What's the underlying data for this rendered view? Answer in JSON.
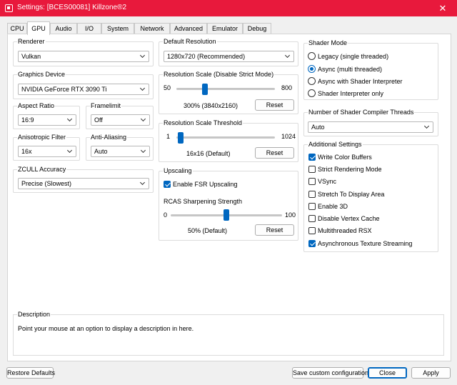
{
  "window": {
    "title": "Settings: [BCES00081] Killzone®2",
    "close_glyph": "✕"
  },
  "tabs": [
    {
      "label": "CPU"
    },
    {
      "label": "GPU"
    },
    {
      "label": "Audio"
    },
    {
      "label": "I/O"
    },
    {
      "label": "System"
    },
    {
      "label": "Network"
    },
    {
      "label": "Advanced"
    },
    {
      "label": "Emulator"
    },
    {
      "label": "Debug"
    }
  ],
  "active_tab": "GPU",
  "renderer": {
    "label": "Renderer",
    "value": "Vulkan"
  },
  "graphics_device": {
    "label": "Graphics Device",
    "value": "NVIDIA GeForce RTX 3090 Ti"
  },
  "aspect_ratio": {
    "label": "Aspect Ratio",
    "value": "16:9"
  },
  "framelimit": {
    "label": "Framelimit",
    "value": "Off"
  },
  "anisotropic_filter": {
    "label": "Anisotropic Filter",
    "value": "16x"
  },
  "anti_aliasing": {
    "label": "Anti-Aliasing",
    "value": "Auto"
  },
  "zcull_accuracy": {
    "label": "ZCULL Accuracy",
    "value": "Precise (Slowest)"
  },
  "default_resolution": {
    "label": "Default Resolution",
    "value": "1280x720 (Recommended)"
  },
  "resolution_scale": {
    "label": "Resolution Scale (Disable Strict Mode)",
    "min": "50",
    "max": "800",
    "value_text": "300% (3840x2160)",
    "reset": "Reset",
    "position": 0.29
  },
  "resolution_scale_threshold": {
    "label": "Resolution Scale Threshold",
    "min": "1",
    "max": "1024",
    "value_text": "16x16 (Default)",
    "reset": "Reset",
    "position": 0.04
  },
  "upscaling": {
    "label": "Upscaling",
    "enable_fsr": {
      "label": "Enable FSR Upscaling",
      "checked": true
    },
    "rcas_label": "RCAS Sharpening Strength",
    "min": "0",
    "max": "100",
    "value_text": "50% (Default)",
    "reset": "Reset",
    "position": 0.5
  },
  "shader_mode": {
    "label": "Shader Mode",
    "options": [
      {
        "label": "Legacy (single threaded)",
        "checked": false
      },
      {
        "label": "Async (multi threaded)",
        "checked": true
      },
      {
        "label": "Async with Shader Interpreter",
        "checked": false
      },
      {
        "label": "Shader Interpreter only",
        "checked": false
      }
    ]
  },
  "shader_compiler_threads": {
    "label": "Number of Shader Compiler Threads",
    "value": "Auto"
  },
  "additional_settings": {
    "label": "Additional Settings",
    "items": [
      {
        "label": "Write Color Buffers",
        "checked": true
      },
      {
        "label": "Strict Rendering Mode",
        "checked": false
      },
      {
        "label": "VSync",
        "checked": false
      },
      {
        "label": "Stretch To Display Area",
        "checked": false
      },
      {
        "label": "Enable 3D",
        "checked": false
      },
      {
        "label": "Disable Vertex Cache",
        "checked": false
      },
      {
        "label": "Multithreaded RSX",
        "checked": false
      },
      {
        "label": "Asynchronous Texture Streaming",
        "checked": true
      }
    ]
  },
  "description": {
    "label": "Description",
    "text": "Point your mouse at an option to display a description in here."
  },
  "footer": {
    "restore_defaults": "Restore Defaults",
    "save_custom": "Save custom configuration",
    "close": "Close",
    "apply": "Apply"
  },
  "colors": {
    "titlebar": "#e8193c",
    "accent": "#0067c0"
  }
}
